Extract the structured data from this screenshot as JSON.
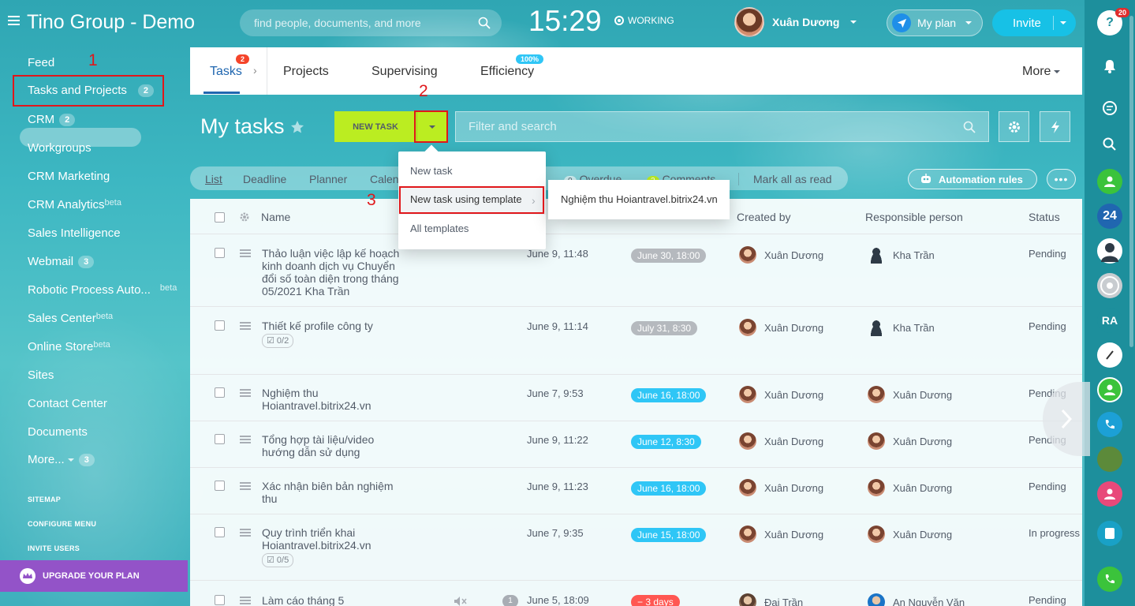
{
  "header": {
    "title": "Tino Group - Demo",
    "search_placeholder": "find people, documents, and more",
    "clock": "15:29",
    "work_status": "WORKING",
    "user_name": "Xuân Dương",
    "my_plan": "My plan",
    "invite": "Invite"
  },
  "left_menu": {
    "items": [
      {
        "label": "Feed"
      },
      {
        "label": "Tasks and Projects",
        "count": "2"
      },
      {
        "label": "CRM",
        "count": "2"
      },
      {
        "label": "Workgroups"
      },
      {
        "label": "CRM Marketing"
      },
      {
        "label": "CRM Analytics",
        "beta": "beta"
      },
      {
        "label": "Sales Intelligence"
      },
      {
        "label": "Webmail",
        "count": "3"
      },
      {
        "label": "Robotic Process Auto...",
        "beta": "beta"
      },
      {
        "label": "Sales Center",
        "beta": "beta"
      },
      {
        "label": "Online Store",
        "beta": "beta"
      },
      {
        "label": "Sites"
      },
      {
        "label": "Contact Center"
      },
      {
        "label": "Documents"
      },
      {
        "label": "More...",
        "count": "3"
      }
    ],
    "sitemap": "SITEMAP",
    "configure": "CONFIGURE MENU",
    "invite_users": "INVITE USERS",
    "upgrade": "UPGRADE YOUR PLAN"
  },
  "annotations": [
    "1",
    "2",
    "3"
  ],
  "topnav": {
    "tabs": [
      {
        "label": "Tasks",
        "badge": "2"
      },
      {
        "label": "Projects"
      },
      {
        "label": "Supervising"
      },
      {
        "label": "Efficiency",
        "badge": "100%"
      }
    ],
    "more": "More"
  },
  "page": {
    "title": "My tasks",
    "new_task": "NEW TASK",
    "filter_placeholder": "Filter and search"
  },
  "views": {
    "list": "List",
    "deadline": "Deadline",
    "planner": "Planner",
    "calendar": "Calendar",
    "overdue_count": "0",
    "overdue": "Overdue",
    "comments_count": "2",
    "comments": "Comments",
    "mark_all": "Mark all as read",
    "automation": "Automation rules"
  },
  "dropdown": {
    "new_task": "New task",
    "new_task_template": "New task using template",
    "all_templates": "All templates",
    "template_item": "Nghiệm thu Hoiantravel.bitrix24.vn"
  },
  "table": {
    "headers": {
      "name": "Name",
      "created_by": "Created by",
      "responsible": "Responsible person",
      "status": "Status"
    },
    "rows": [
      {
        "name": "Thảo luận việc lập kế hoạch kinh doanh dịch vụ Chuyển đổi số toàn diện trong tháng 05/2021 Kha Trần",
        "date": "June 9, 11:48",
        "deadline": "June 30, 18:00",
        "deadline_color": "#b5b9be",
        "created_by": "Xuân Dương",
        "responsible": "Kha Trần",
        "status": "Pending"
      },
      {
        "name": "Thiết kế profile công ty",
        "checklist": "0/2",
        "date": "June 9, 11:14",
        "deadline": "July 31, 8:30",
        "deadline_color": "#b5b9be",
        "created_by": "Xuân Dương",
        "responsible": "Kha Trần",
        "status": "Pending"
      },
      {
        "name": "Nghiệm thu Hoiantravel.bitrix24.vn",
        "date": "June 7, 9:53",
        "deadline": "June 16, 18:00",
        "deadline_color": "#2fc6f6",
        "created_by": "Xuân Dương",
        "responsible": "Xuân Dương",
        "status": "Pending"
      },
      {
        "name": "Tổng hợp tài liệu/video hướng dẫn sử dụng",
        "date": "June 9, 11:22",
        "deadline": "June 12, 8:30",
        "deadline_color": "#2fc6f6",
        "created_by": "Xuân Dương",
        "responsible": "Xuân Dương",
        "status": "Pending"
      },
      {
        "name": "Xác nhận biên bản nghiệm thu",
        "date": "June 9, 11:23",
        "deadline": "June 16, 18:00",
        "deadline_color": "#2fc6f6",
        "created_by": "Xuân Dương",
        "responsible": "Xuân Dương",
        "status": "Pending"
      },
      {
        "name": "Quy trình triển khai Hoiantravel.bitrix24.vn",
        "checklist": "0/5",
        "date": "June 7, 9:35",
        "deadline": "June 15, 18:00",
        "deadline_color": "#2fc6f6",
        "created_by": "Xuân Dương",
        "responsible": "Xuân Dương",
        "status": "In progress"
      },
      {
        "name": "Làm cáo tháng 5",
        "comment_count": "1",
        "date": "June 5, 18:09",
        "deadline": "− 3 days",
        "deadline_color": "#ff5752",
        "created_by": "Đại Trần",
        "responsible": "An Nguyễn Văn",
        "status": "Pending"
      }
    ]
  },
  "right_bar": {
    "help_badge": "20",
    "counter_24": "24"
  }
}
